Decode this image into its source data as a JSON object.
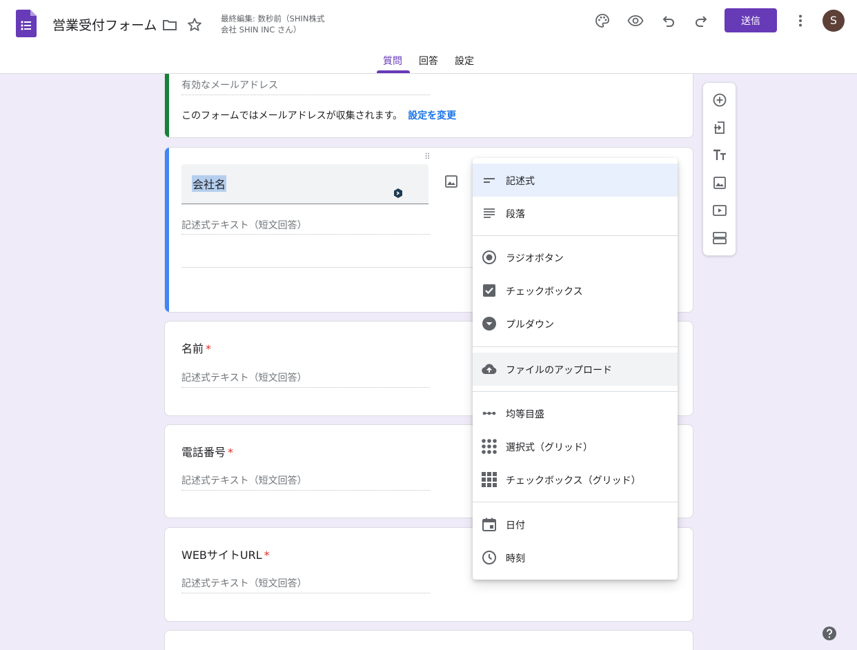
{
  "header": {
    "form_title": "営業受付フォーム",
    "last_edit_line1": "最終編集: 数秒前（SHIN株式",
    "last_edit_line2": "会社 SHIN INC さん）",
    "send_label": "送信",
    "avatar_initial": "S"
  },
  "tabs": [
    {
      "label": "質問",
      "active": true
    },
    {
      "label": "回答",
      "active": false
    },
    {
      "label": "設定",
      "active": false
    }
  ],
  "email_section": {
    "placeholder": "有効なメールアドレス",
    "note": "このフォームではメールアドレスが収集されます。",
    "link": "設定を変更"
  },
  "active_question": {
    "title": "会社名",
    "answer_placeholder": "記述式テキスト（短文回答）"
  },
  "questions": [
    {
      "label": "名前",
      "required_mark": "*",
      "placeholder": "記述式テキスト（短文回答）"
    },
    {
      "label": "電話番号",
      "required_mark": "*",
      "placeholder": "記述式テキスト（短文回答）"
    },
    {
      "label": "WEBサイトURL",
      "required_mark": "*",
      "placeholder": "記述式テキスト（短文回答）"
    }
  ],
  "question_type_menu": {
    "items": [
      {
        "label": "記述式",
        "icon": "short-answer-icon",
        "selected": true
      },
      {
        "label": "段落",
        "icon": "paragraph-icon"
      },
      {
        "label": "ラジオボタン",
        "icon": "radio-button-icon"
      },
      {
        "label": "チェックボックス",
        "icon": "checkbox-icon"
      },
      {
        "label": "プルダウン",
        "icon": "dropdown-icon"
      },
      {
        "label": "ファイルのアップロード",
        "icon": "cloud-upload-icon",
        "hovered": true
      },
      {
        "label": "均等目盛",
        "icon": "linear-scale-icon"
      },
      {
        "label": "選択式（グリッド）",
        "icon": "grid-dots-icon"
      },
      {
        "label": "チェックボックス（グリッド）",
        "icon": "grid-squares-icon"
      },
      {
        "label": "日付",
        "icon": "calendar-icon"
      },
      {
        "label": "時刻",
        "icon": "clock-icon"
      }
    ]
  },
  "colors": {
    "accent": "#673ab7",
    "active_question_bar": "#4285f4",
    "email_section_bar": "#188038",
    "selected_menu_bg": "#e8f0fe",
    "hover_menu_bg": "#f1f3f4",
    "background": "#f0ebf8"
  }
}
